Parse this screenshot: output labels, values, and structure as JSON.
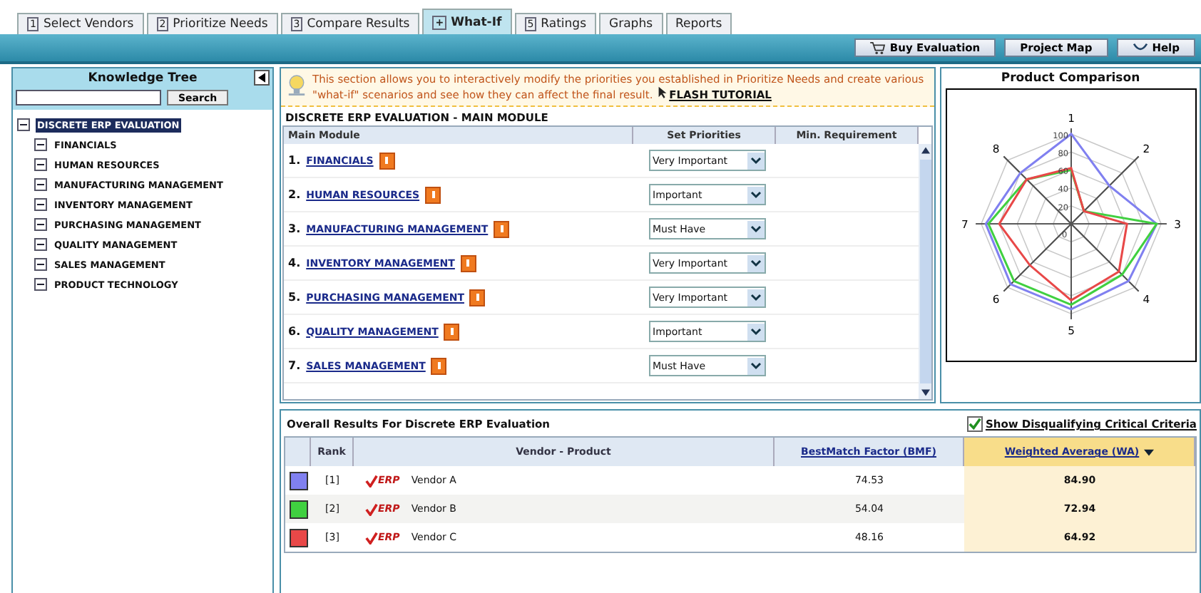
{
  "tabs": [
    {
      "number": "1",
      "label": "Select Vendors",
      "selected": false
    },
    {
      "number": "2",
      "label": "Prioritize Needs",
      "selected": false
    },
    {
      "number": "3",
      "label": "Compare Results",
      "selected": false
    },
    {
      "number": "+",
      "label": "What-If",
      "selected": true
    },
    {
      "number": "5",
      "label": "Ratings",
      "selected": false
    },
    {
      "label": "Graphs",
      "selected": false
    },
    {
      "label": "Reports",
      "selected": false
    }
  ],
  "toolbar": [
    "Buy Evaluation",
    "Project Map",
    "Help"
  ],
  "knowledge_tree": {
    "title": "Knowledge Tree",
    "search_button": "Search",
    "items": [
      {
        "label": "DISCRETE ERP EVALUATION",
        "selected": true,
        "expanded": true,
        "children": [
          {
            "label": "FINANCIALS",
            "selected": false
          },
          {
            "label": "HUMAN RESOURCES",
            "selected": false
          },
          {
            "label": "MANUFACTURING MANAGEMENT",
            "selected": false
          },
          {
            "label": "INVENTORY MANAGEMENT",
            "selected": false
          },
          {
            "label": "PURCHASING MANAGEMENT",
            "selected": false
          },
          {
            "label": "QUALITY MANAGEMENT",
            "selected": false
          },
          {
            "label": "SALES MANAGEMENT",
            "selected": false
          },
          {
            "label": "PRODUCT TECHNOLOGY",
            "selected": false
          }
        ]
      }
    ]
  },
  "info": {
    "text": "This section allows you to interactively modify the priorities you established in Prioritize Needs and create various \"what-if\" scenarios and see how they can affect the final result.",
    "link": "FLASH TUTORIAL"
  },
  "modules": {
    "title": "DISCRETE ERP EVALUATION - MAIN MODULE",
    "columns": [
      "Main Module",
      "Set Priorities",
      "Min. Requirement"
    ],
    "rows": [
      {
        "number": "1.",
        "name": "FINANCIALS",
        "priority": "Very Important"
      },
      {
        "number": "2.",
        "name": "HUMAN RESOURCES",
        "priority": "Important"
      },
      {
        "number": "3.",
        "name": "MANUFACTURING MANAGEMENT",
        "priority": "Must Have"
      },
      {
        "number": "4.",
        "name": "INVENTORY MANAGEMENT",
        "priority": "Very Important"
      },
      {
        "number": "5.",
        "name": "PURCHASING MANAGEMENT",
        "priority": "Very Important"
      },
      {
        "number": "6.",
        "name": "QUALITY MANAGEMENT",
        "priority": "Important"
      },
      {
        "number": "7.",
        "name": "SALES MANAGEMENT",
        "priority": "Must Have"
      }
    ]
  },
  "product_comparison": {
    "title": "Product Comparison",
    "axes": [
      "1",
      "2",
      "3",
      "4",
      "5",
      "6",
      "7",
      "8"
    ],
    "ticks": [
      "100",
      "80",
      "60",
      "40",
      "20",
      "0"
    ]
  },
  "results": {
    "title": "Overall Results For Discrete ERP Evaluation",
    "show_disqualifying": {
      "label": "Show Disqualifying Critical Criteria",
      "checked": true
    },
    "columns": [
      "Rank",
      "Vendor - Product",
      "BestMatch Factor (BMF)",
      "Weighted Average (WA)"
    ],
    "rows": [
      {
        "color": "#8080f0",
        "rank": "[1]",
        "badge": "ERP",
        "vendor": "Vendor A",
        "bmf": "74.53",
        "wa": "84.90"
      },
      {
        "color": "#40d040",
        "rank": "[2]",
        "badge": "ERP",
        "vendor": "Vendor B",
        "bmf": "54.04",
        "wa": "72.94"
      },
      {
        "color": "#e84848",
        "rank": "[3]",
        "badge": "ERP",
        "vendor": "Vendor C",
        "bmf": "48.16",
        "wa": "64.92"
      }
    ]
  }
}
